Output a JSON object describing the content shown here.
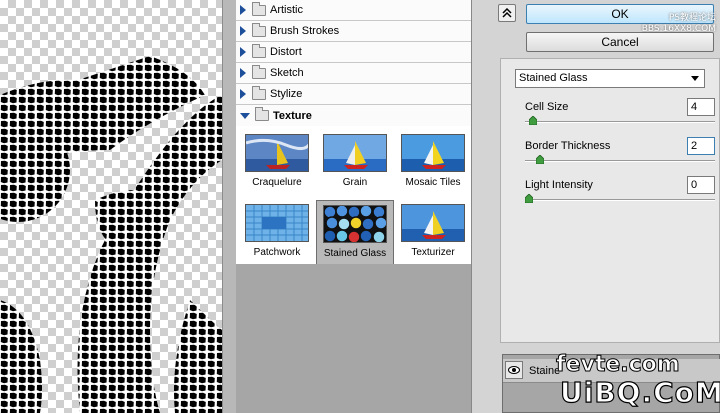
{
  "gallery": {
    "categories": [
      {
        "label": "Artistic",
        "expanded": false
      },
      {
        "label": "Brush Strokes",
        "expanded": false
      },
      {
        "label": "Distort",
        "expanded": false
      },
      {
        "label": "Sketch",
        "expanded": false
      },
      {
        "label": "Stylize",
        "expanded": false
      },
      {
        "label": "Texture",
        "expanded": true
      }
    ],
    "texture_filters": [
      {
        "label": "Craquelure",
        "selected": false
      },
      {
        "label": "Grain",
        "selected": false
      },
      {
        "label": "Mosaic Tiles",
        "selected": false
      },
      {
        "label": "Patchwork",
        "selected": false
      },
      {
        "label": "Stained Glass",
        "selected": true
      },
      {
        "label": "Texturizer",
        "selected": false
      }
    ]
  },
  "buttons": {
    "ok": "OK",
    "cancel": "Cancel",
    "collapse_icon": "double-chevron-up-icon"
  },
  "options": {
    "filter_selected": "Stained Glass",
    "params": [
      {
        "label": "Cell Size",
        "value": "4",
        "slider_fraction": 0.02
      },
      {
        "label": "Border Thickness",
        "value": "2",
        "slider_fraction": 0.06
      },
      {
        "label": "Light Intensity",
        "value": "0",
        "slider_fraction": 0.0
      }
    ]
  },
  "layers": {
    "row_name": "Staine",
    "eye_icon": "eye-icon"
  },
  "watermarks": {
    "top": "PS教程论坛\nBBS.16XX8.COM",
    "fevte": "fevte.com",
    "uibq": "UiBQ.CoM"
  },
  "colors": {
    "ok_border": "#3c7fb1",
    "category_triangle": "#1d4f9a",
    "panel_bg": "#d4d4d4"
  }
}
